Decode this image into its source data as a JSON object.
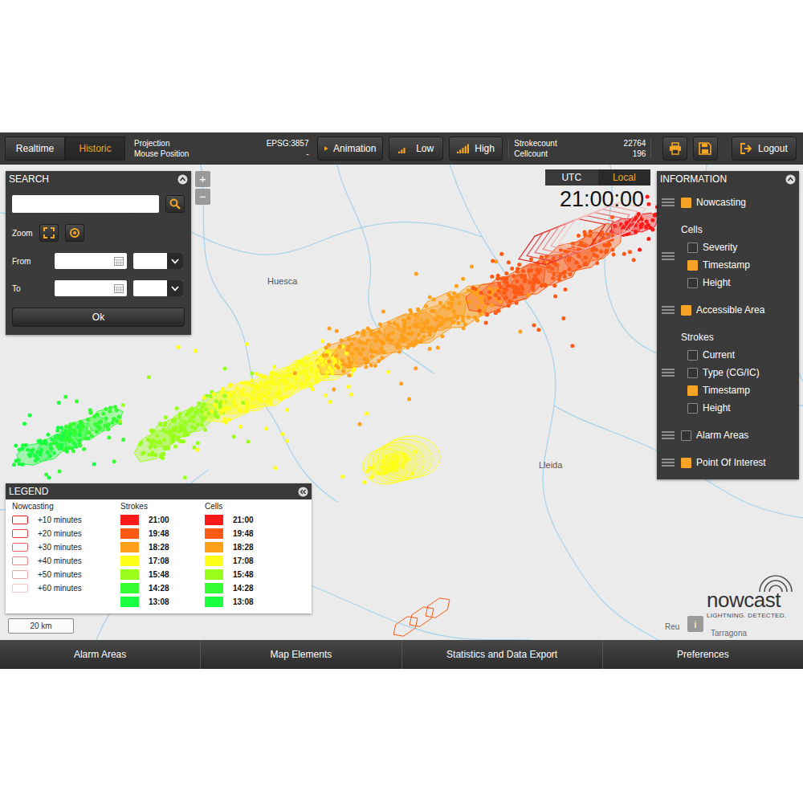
{
  "toolbar": {
    "modes": [
      {
        "label": "Realtime",
        "selected": false
      },
      {
        "label": "Historic",
        "selected": true
      }
    ],
    "projection": {
      "label": "Projection",
      "value": "EPSG:3857"
    },
    "mouse": {
      "label": "Mouse Position",
      "value": "-"
    },
    "animation": "Animation",
    "quality": [
      {
        "label": "Low"
      },
      {
        "label": "High"
      }
    ],
    "counts": [
      {
        "label": "Strokecount",
        "value": "22764"
      },
      {
        "label": "Cellcount",
        "value": "196"
      }
    ],
    "logout": "Logout"
  },
  "search": {
    "title": "SEARCH",
    "zoom_label": "Zoom",
    "from_label": "From",
    "to_label": "To",
    "ok": "Ok"
  },
  "zoom_controls": [
    "+",
    "−"
  ],
  "clock": {
    "zones": [
      {
        "label": "UTC",
        "selected": false
      },
      {
        "label": "Local",
        "selected": true
      }
    ],
    "time": "21:00:00"
  },
  "information": {
    "title": "INFORMATION",
    "groups": [
      {
        "items": [
          {
            "label": "Nowcasting",
            "checked": true
          }
        ]
      },
      {
        "heading": "Cells",
        "items": [
          {
            "label": "Severity",
            "checked": false
          },
          {
            "label": "Timestamp",
            "checked": true
          },
          {
            "label": "Height",
            "checked": false
          }
        ]
      },
      {
        "items": [
          {
            "label": "Accessible Area",
            "checked": true
          }
        ]
      },
      {
        "heading": "Strokes",
        "items": [
          {
            "label": "Current",
            "checked": false
          },
          {
            "label": "Type (CG/IC)",
            "checked": false
          },
          {
            "label": "Timestamp",
            "checked": true
          },
          {
            "label": "Height",
            "checked": false
          }
        ]
      },
      {
        "items": [
          {
            "label": "Alarm Areas",
            "checked": false
          }
        ]
      },
      {
        "items": [
          {
            "label": "Point Of Interest",
            "checked": true
          }
        ]
      }
    ]
  },
  "legend": {
    "title": "LEGEND",
    "nowcasting": {
      "title": "Nowcasting",
      "items": [
        {
          "label": "+10 minutes",
          "color": "#e02020"
        },
        {
          "label": "+20 minutes",
          "color": "#e44545"
        },
        {
          "label": "+30 minutes",
          "color": "#e86464"
        },
        {
          "label": "+40 minutes",
          "color": "#ec8585"
        },
        {
          "label": "+50 minutes",
          "color": "#f0a5a5"
        },
        {
          "label": "+60 minutes",
          "color": "#f5c6c6"
        }
      ]
    },
    "strokes": {
      "title": "Strokes",
      "items": [
        {
          "time": "21:00",
          "color": "#ff1a1a"
        },
        {
          "time": "19:48",
          "color": "#ff5a14"
        },
        {
          "time": "18:28",
          "color": "#ff9f1a"
        },
        {
          "time": "17:08",
          "color": "#ffff1a"
        },
        {
          "time": "15:48",
          "color": "#99ff1a"
        },
        {
          "time": "14:28",
          "color": "#33ff33"
        },
        {
          "time": "13:08",
          "color": "#1aff40"
        }
      ]
    },
    "cells": {
      "title": "Cells",
      "items": [
        {
          "time": "21:00",
          "color": "#ff1a1a"
        },
        {
          "time": "19:48",
          "color": "#ff5a14"
        },
        {
          "time": "18:28",
          "color": "#ff9f1a"
        },
        {
          "time": "17:08",
          "color": "#ffff1a"
        },
        {
          "time": "15:48",
          "color": "#99ff1a"
        },
        {
          "time": "14:28",
          "color": "#33ff33"
        },
        {
          "time": "13:08",
          "color": "#1aff40"
        }
      ]
    }
  },
  "map": {
    "places": [
      {
        "name": "Huesca"
      },
      {
        "name": "Lleida"
      },
      {
        "name": "Reu"
      },
      {
        "name": "Tarragona"
      }
    ],
    "scale": "20 km"
  },
  "info_button": "i",
  "logo": {
    "name": "nowcast",
    "tagline": "LIGHTNING. DETECTED."
  },
  "bottom_bar": [
    "Alarm Areas",
    "Map Elements",
    "Statistics and Data Export",
    "Preferences"
  ]
}
